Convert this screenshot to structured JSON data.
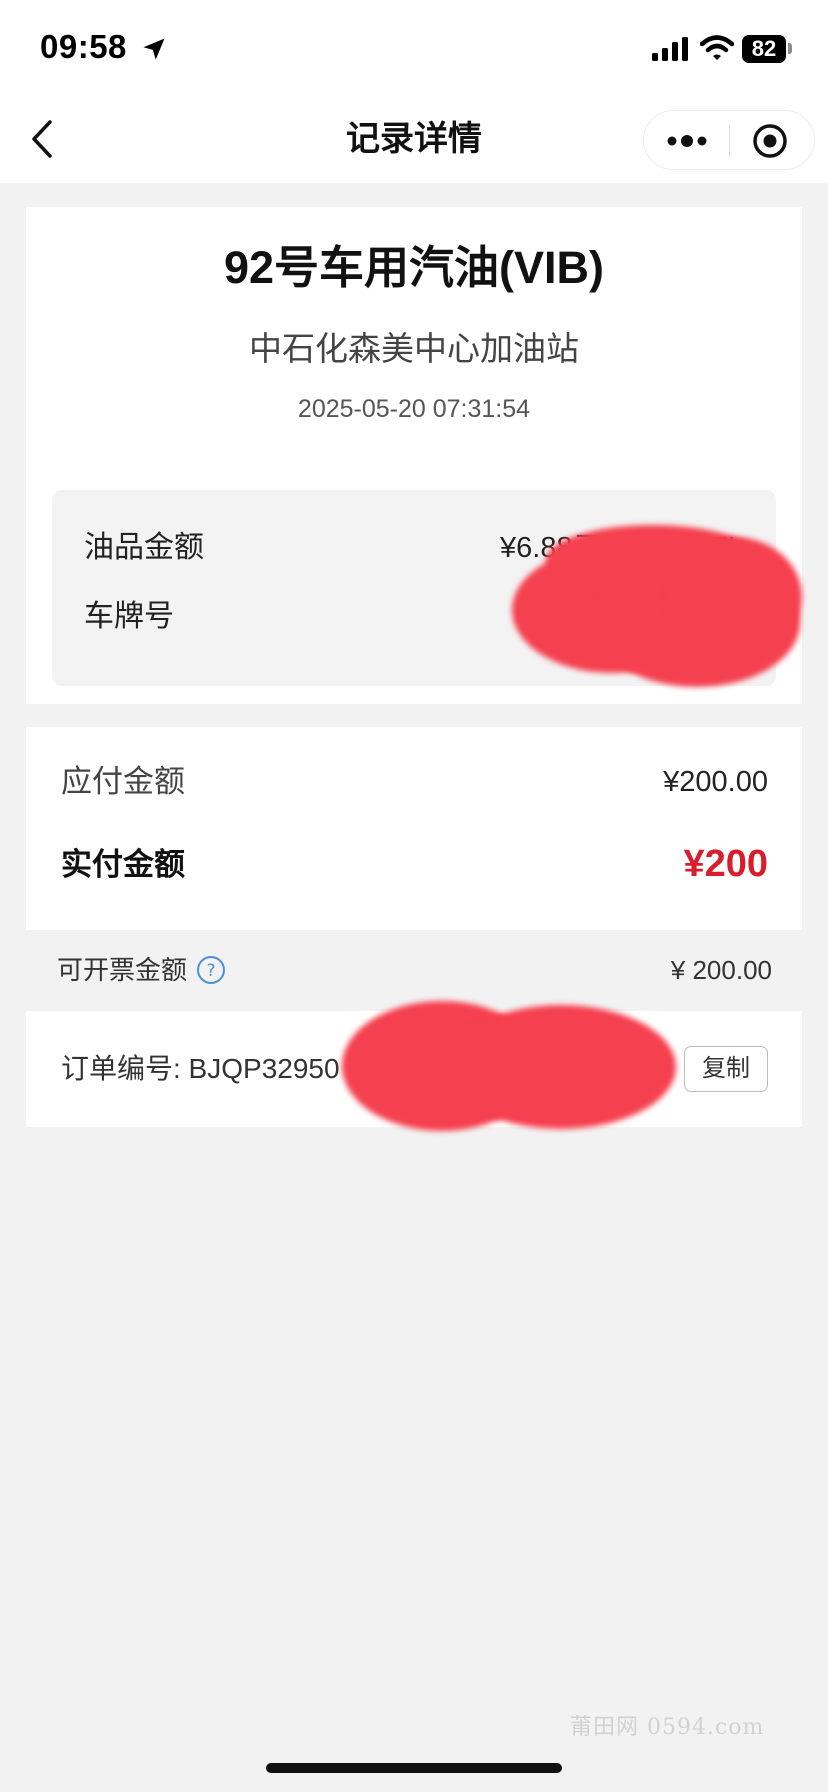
{
  "status_bar": {
    "time": "09:58",
    "battery": "82"
  },
  "nav": {
    "title": "记录详情"
  },
  "record": {
    "fuel_name": "92号车用汽油(VIB)",
    "station": "中石化森美中心加油站",
    "datetime": "2025-05-20 07:31:54",
    "oil_amount_label": "油品金额",
    "oil_amount_value": "¥6.88元/L x 29.07L",
    "plate_label": "车牌号"
  },
  "payment": {
    "payable_label": "应付金额",
    "payable_value": "¥200.00",
    "paid_label": "实付金额",
    "paid_value": "¥200"
  },
  "invoice": {
    "label": "可开票金额",
    "value": "¥ 200.00"
  },
  "order": {
    "label": "订单编号: BJQP32950",
    "copy_label": "复制"
  },
  "watermark": "莆田网 0594.com",
  "colors": {
    "accent_red": "#d81e2c",
    "redaction": "#f5404f",
    "help_blue": "#4a90d9"
  }
}
